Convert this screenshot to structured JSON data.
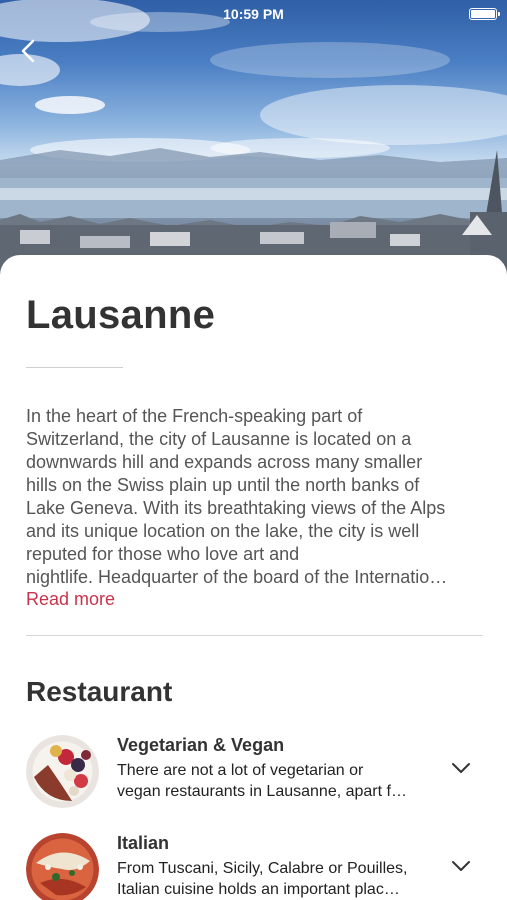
{
  "status_bar": {
    "time": "10:59 PM"
  },
  "city": {
    "name": "Lausanne",
    "description_lines": [
      "In the heart of the French-speaking part of",
      "Switzerland, the city of Lausanne is located on a",
      "downwards hill and expands across many smaller",
      "hills on the Swiss plain up until the north banks of",
      "Lake Geneva. With its breathtaking views of the Alps",
      "and its unique location on the lake, the city is well",
      "reputed for those who love art and",
      "nightlife. Headquarter of the board of the Internatio…"
    ],
    "read_more": "Read more"
  },
  "restaurants": {
    "heading": "Restaurant",
    "items": [
      {
        "title": "Vegetarian & Vegan",
        "text_lines": [
          "There are not a lot of vegetarian or",
          "vegan restaurants in Lausanne, apart f…"
        ]
      },
      {
        "title": "Italian",
        "text_lines": [
          "From Tuscani, Sicily, Calabre or Pouilles,",
          "Italian cuisine holds an important plac…"
        ]
      }
    ]
  },
  "colors": {
    "accent": "#c8334b",
    "text": "#333333"
  }
}
